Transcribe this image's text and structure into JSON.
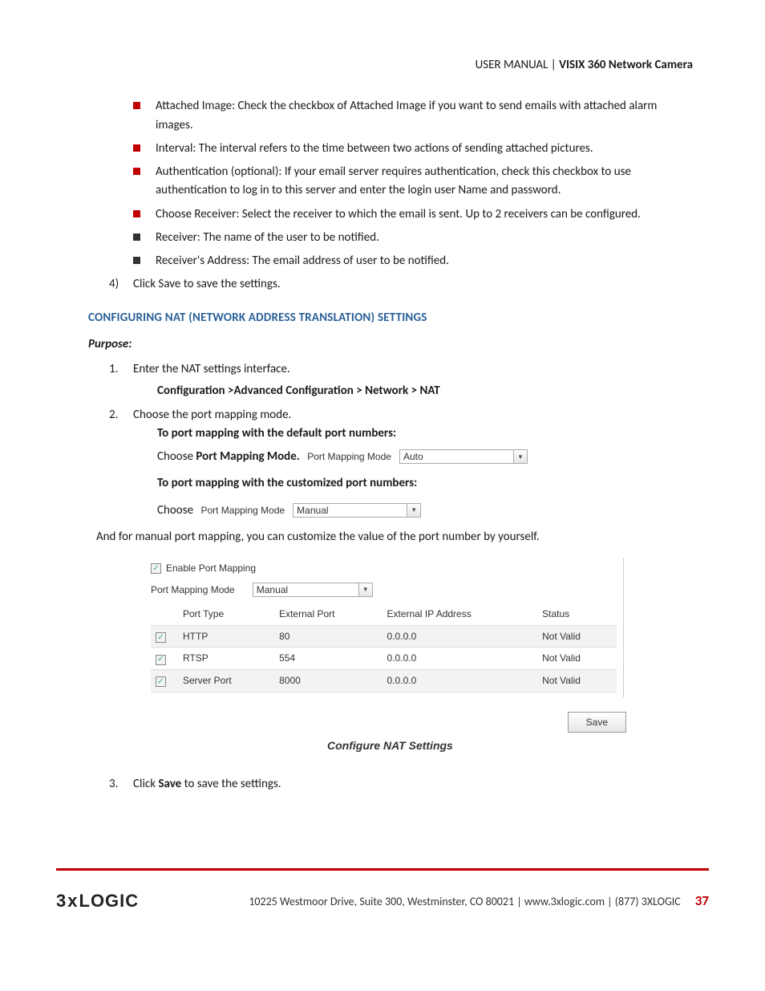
{
  "header": {
    "left": "USER MANUAL | ",
    "right": "VISIX 360 Network Camera"
  },
  "bullets_red": [
    "Attached Image: Check the checkbox of Attached Image if you want to send emails with attached alarm images.",
    "Interval: The interval refers to the time between two actions of sending attached pictures.",
    "Authentication (optional): If your email server requires authentication, check this checkbox to use authentication to log in to this server and enter the login user Name and password.",
    "Choose Receiver: Select the receiver to which the email is sent. Up to 2 receivers can be configured."
  ],
  "bullets_dark": [
    "Receiver: The name of the user to be notified.",
    "Receiver's Address: The email address of user to be notified."
  ],
  "step4": {
    "num": "4)",
    "text": "Click Save to save the settings."
  },
  "section_heading": "CONFIGURING NAT (NETWORK ADDRESS TRANSLATION) SETTINGS",
  "purpose_label": "Purpose:",
  "nat_steps": {
    "s1": {
      "num": "1.",
      "text": "Enter the NAT settings interface.",
      "path": "Configuration >Advanced Configuration > Network > NAT"
    },
    "s2": {
      "num": "2.",
      "text": "Choose the port mapping mode.",
      "line_a": "To port mapping with the default port numbers:",
      "choose_a_pre": "Choose ",
      "choose_a_bold": "Port Mapping Mode.",
      "fig_a": {
        "label": "Port Mapping Mode",
        "value": "Auto"
      },
      "line_b": "To port mapping with the customized port numbers:",
      "choose_b": "Choose",
      "fig_b": {
        "label": "Port Mapping Mode",
        "value": "Manual"
      }
    },
    "note": "And for manual port mapping, you can customize the value of the port number by yourself.",
    "s3": {
      "num": "3.",
      "pre": "Click ",
      "bold": "Save",
      "post": " to save the settings."
    }
  },
  "nat_figure": {
    "enable_label": "Enable Port Mapping",
    "mode_label": "Port Mapping Mode",
    "mode_value": "Manual",
    "headers": [
      "",
      "Port Type",
      "External Port",
      "External IP Address",
      "Status"
    ],
    "rows": [
      {
        "type": "HTTP",
        "port": "80",
        "ip": "0.0.0.0",
        "status": "Not Valid"
      },
      {
        "type": "RTSP",
        "port": "554",
        "ip": "0.0.0.0",
        "status": "Not Valid"
      },
      {
        "type": "Server Port",
        "port": "8000",
        "ip": "0.0.0.0",
        "status": "Not Valid"
      }
    ],
    "save": "Save",
    "caption": "Configure NAT Settings"
  },
  "footer": {
    "logo": "3xLOGIC",
    "addr": "10225 Westmoor Drive, Suite 300, Westminster, CO 80021 | www.3xlogic.com | (877) 3XLOGIC",
    "page": "37"
  }
}
